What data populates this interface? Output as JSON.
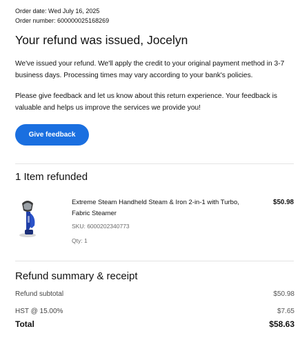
{
  "order": {
    "date_line": "Order date: Wed July 16, 2025",
    "number_line": "Order number: 600000025168269"
  },
  "headline": "Your refund was issued, Jocelyn",
  "messages": {
    "refund_info": "We've issued your refund. We'll apply the credit to your original payment method in 3-7 business days. Processing times may vary according to your bank's policies.",
    "feedback_prompt": "Please give feedback and let us know about this return experience. Your feedback is valuable and helps us improve the services we provide you!"
  },
  "feedback_button": {
    "label": "Give feedback",
    "color": "#1a6fe0"
  },
  "items_section": {
    "title": "1 Item refunded",
    "items": [
      {
        "name": "Extreme Steam Handheld Steam & Iron 2-in-1 with Turbo, Fabric Steamer",
        "price": "$50.98",
        "sku": "SKU: 6000202340773",
        "qty": "Qty: 1",
        "image_icon": "handheld-steamer"
      }
    ]
  },
  "summary": {
    "title": "Refund summary & receipt",
    "subtotal_label": "Refund subtotal",
    "subtotal_value": "$50.98",
    "tax_label": "HST @ 15.00%",
    "tax_value": "$7.65",
    "total_label": "Total",
    "total_value": "$58.63"
  }
}
